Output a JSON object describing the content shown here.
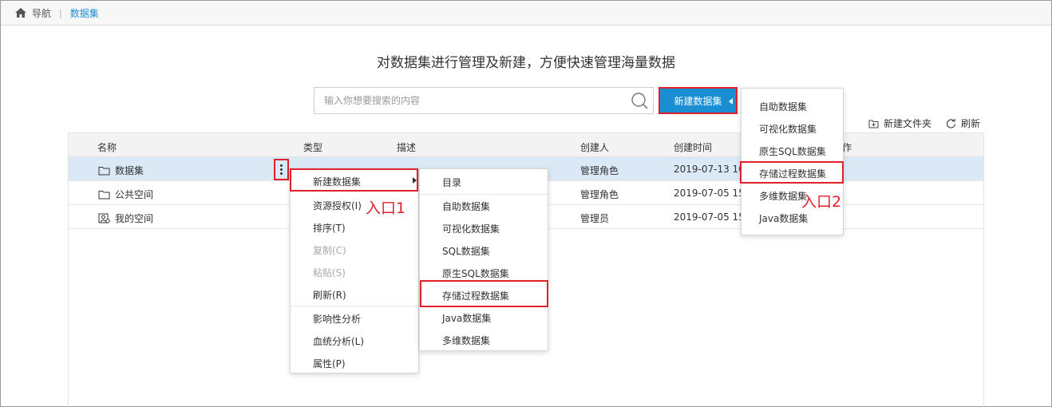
{
  "breadcrumb": {
    "nav": "导航",
    "separator": "|",
    "current": "数据集"
  },
  "page": {
    "title": "对数据集进行管理及新建，方便快速管理海量数据",
    "search_placeholder": "输入你想要搜索的内容",
    "new_dataset_button": "新建数据集"
  },
  "toolbar": {
    "new_folder": "新建文件夹",
    "refresh": "刷新"
  },
  "table": {
    "headers": [
      "名称",
      "类型",
      "描述",
      "创建人",
      "创建时间",
      "作"
    ],
    "rows": [
      {
        "name": "数据集",
        "type": "",
        "desc": "",
        "creator": "管理角色",
        "time": "2019-07-13 10",
        "icon": "folder-icon"
      },
      {
        "name": "公共空间",
        "type": "",
        "desc": "",
        "creator": "管理角色",
        "time": "2019-07-05 15",
        "icon": "folder-icon"
      },
      {
        "name": "我的空间",
        "type": "",
        "desc": "",
        "creator": "管理员",
        "time": "2019-07-05 15",
        "icon": "user-space-icon"
      }
    ]
  },
  "context_menu": {
    "items": [
      "新建数据集",
      "资源授权(I)",
      "排序(T)",
      "复制(C)",
      "粘贴(S)",
      "刷新(R)",
      "影响性分析",
      "血统分析(L)",
      "属性(P)"
    ],
    "disabled": [
      "复制(C)",
      "粘贴(S)"
    ]
  },
  "submenu": {
    "items": [
      "目录",
      "自助数据集",
      "可视化数据集",
      "SQL数据集",
      "原生SQL数据集",
      "存储过程数据集",
      "Java数据集",
      "多维数据集"
    ]
  },
  "dropdown": {
    "items": [
      "自助数据集",
      "可视化数据集",
      "原生SQL数据集",
      "存储过程数据集",
      "多维数据集",
      "Java数据集"
    ]
  },
  "annotations": {
    "entry1": "入口1",
    "entry2": "入口2"
  },
  "colors": {
    "accent": "#1a8ed3",
    "highlight": "#e0212b",
    "selected_row": "#dbe9f6"
  }
}
